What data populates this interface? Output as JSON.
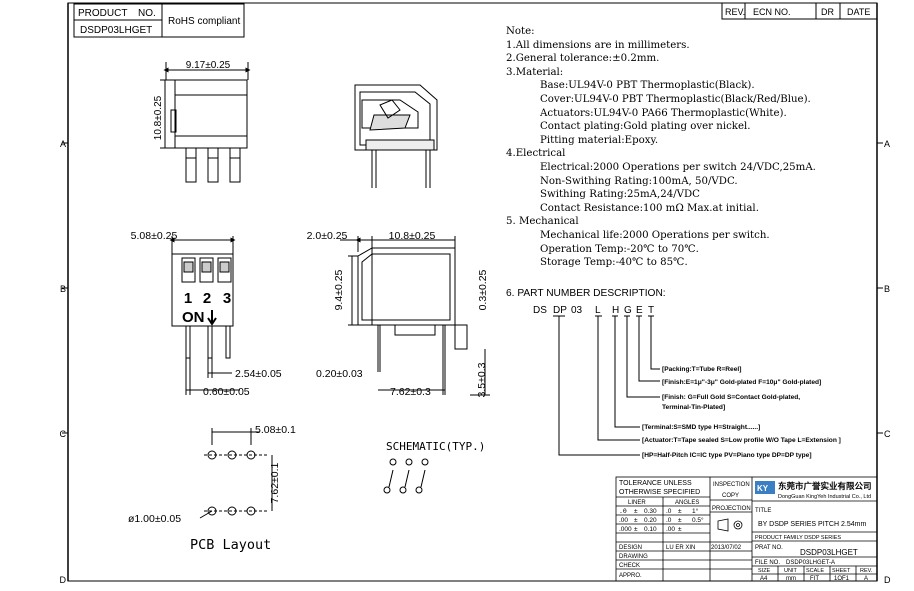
{
  "header": {
    "product_label": "PRODUCT",
    "no_label": "NO.",
    "product_no": "DSDP03LHGET",
    "rohs": "RoHS compliant",
    "rev_label": "REV.",
    "ecn_label": "ECN NO.",
    "dr_label": "DR",
    "date_label": "DATE"
  },
  "zones": [
    "A",
    "B",
    "C",
    "D"
  ],
  "dimensions": {
    "top_width": "9.17±0.25",
    "side_height": "10.8±0.25",
    "pitch_front": "5.08±0.25",
    "side_a": "2.0±0.25",
    "side_b": "10.8±0.25",
    "side_height2": "9.4±0.25",
    "right_small": "0.3±0.25",
    "pin_pitch": "2.54±0.05",
    "pin_width": "0.60±0.05",
    "pin_thick": "0.20±0.03",
    "side_depth": "7.62±0.3",
    "pin_len": "3.5±0.3",
    "pcb_pitch": "5.08±0.1",
    "pcb_row": "7.62±0.1",
    "hole": "ø1.00±0.05"
  },
  "front_labels": {
    "num1": "1",
    "num2": "2",
    "num3": "3",
    "on": "ON"
  },
  "pcb_title": "PCB Layout",
  "schematic_title": "SCHEMATIC(TYP.)",
  "notes": [
    {
      "t": "Note:",
      "in": false
    },
    {
      "t": "1.All dimensions are in millimeters.",
      "in": false
    },
    {
      "t": "2.General tolerance:±0.2mm.",
      "in": false
    },
    {
      "t": "3.Material:",
      "in": false
    },
    {
      "t": "Base:UL94V-0 PBT Thermoplastic(Black).",
      "in": true
    },
    {
      "t": "Cover:UL94V-0 PBT Thermoplastic(Black/Red/Blue).",
      "in": true
    },
    {
      "t": "Actuators:UL94V-0 PA66 Thermoplastic(White).",
      "in": true
    },
    {
      "t": "Contact plating:Gold plating over nickel.",
      "in": true
    },
    {
      "t": "Pitting material:Epoxy.",
      "in": true
    },
    {
      "t": "4.Electrical",
      "in": false
    },
    {
      "t": "Electrical:2000 Operations per switch 24/VDC,25mA.",
      "in": true
    },
    {
      "t": "Non-Swithing Rating:100mA, 50/VDC.",
      "in": true
    },
    {
      "t": "Swithing Rating:25mA,24/VDC",
      "in": true
    },
    {
      "t": "Contact Resistance:100 mΩ Max.at initial.",
      "in": true
    },
    {
      "t": "5. Mechanical",
      "in": false
    },
    {
      "t": "Mechanical life:2000 Operations per switch.",
      "in": true
    },
    {
      "t": "Operation Temp:-20℃ to 70℃.",
      "in": true
    },
    {
      "t": "Storage Temp:-40℃ to 85℃.",
      "in": true
    }
  ],
  "part_number": {
    "heading": "6. PART NUMBER DESCRIPTION:",
    "code": [
      "DS",
      "DP",
      "03",
      "L",
      "H",
      "G",
      "E",
      "T"
    ],
    "desc": [
      "[Packing:T=Tube R=Reel]",
      "[Finish:E=1μ\"-3μ\" Gold-plated F=10μ\" Gold-plated]",
      "[Finish: G=Full Gold S=Contact Gold-plated,",
      "Terminal-Tin-Plated]",
      "[Terminal:S=SMD type  H=Straight......]",
      "[Actuator:T=Tape sealed S=Low profile W/O Tape L=Extension ]",
      "[HP=Half-Pitch IC=IC type PV=Piano type DP=DP type]"
    ]
  },
  "title_block": {
    "tol_title": "TOLERANCE UNLESS OTHERWISE SPECIFIED",
    "inspection": "INSPECTION",
    "copy": "COPY",
    "projection": "PROJECTION",
    "liner": "LINER",
    "angles": "ANGLES",
    "tol_rows": [
      [
        ".0",
        "±",
        "0.30",
        ".0",
        "±",
        "1°"
      ],
      [
        ".00",
        "±",
        "0.20",
        ".0",
        "±",
        "0.5°"
      ],
      [
        ".000",
        "±",
        "0.10",
        ".00",
        "±",
        ""
      ]
    ],
    "design_label": "DESIGN",
    "designer": "LU ER XIN",
    "design_date": "2013/07/02",
    "drawing_label": "DRAWING",
    "check_label": "CHECK",
    "appro_label": "APPRO.",
    "company_cn": "东莞市广誉实业有限公司",
    "company_en": "DongGuan KingYeh Industrial Co., Ltd",
    "title_label": "TITLE",
    "title": "BY DSDP SERIES PITCH 2.54mm",
    "family": "PRODUCT FAMILY DSDP SERIES",
    "part_no_label": "PRAT NO.",
    "part_no": "DSDP03LHGET",
    "file_no_label": "FILE NO.",
    "file_no": "DSDP03LHGET-A",
    "size_label": "SIZE",
    "size": "A4",
    "unit_label": "UNIT",
    "unit": "mm",
    "scale_label": "SCALE",
    "scale": "FIT",
    "sheet_label": "SHEET",
    "sheet": "1OF1",
    "rev_label": "REV.",
    "rev": "A"
  }
}
